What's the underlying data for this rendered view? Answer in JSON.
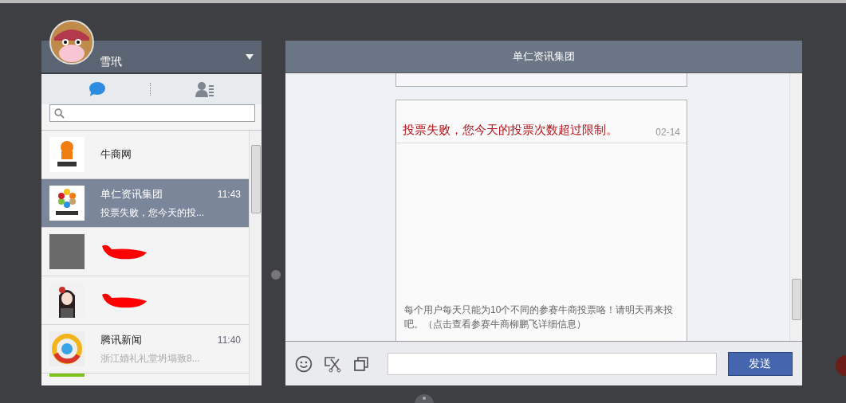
{
  "user": {
    "name": "雪玳"
  },
  "tabs": [
    {
      "kind": "chat",
      "selected": true
    },
    {
      "kind": "contacts",
      "selected": false
    }
  ],
  "contacts": [
    {
      "kind": "mascot",
      "name": "牛商网",
      "selected": false,
      "redacted": false
    },
    {
      "kind": "flower",
      "name": "单仁资讯集团",
      "time": "11:43",
      "preview": "投票失败，您今天的投...",
      "selected": true,
      "redacted": false
    },
    {
      "kind": "photo",
      "selected": false,
      "redacted": true
    },
    {
      "kind": "girl",
      "selected": false,
      "redacted": true
    },
    {
      "kind": "news",
      "name": "腾讯新闻",
      "time": "11:40",
      "preview": "浙江婚礼礼堂坍塌致8...",
      "selected": false,
      "redacted": false
    },
    {
      "kind": "strip",
      "selected": false,
      "redacted": false
    }
  ],
  "chat": {
    "title": "单仁资讯集团",
    "card": {
      "title": "投票失败，您今天的投票次数超过限制。",
      "date": "02-14",
      "body": "每个用户每天只能为10个不同的参赛牛商投票咯！请明天再来投吧。（点击查看参赛牛商柳鹏飞详细信息）"
    },
    "send": "发送"
  }
}
